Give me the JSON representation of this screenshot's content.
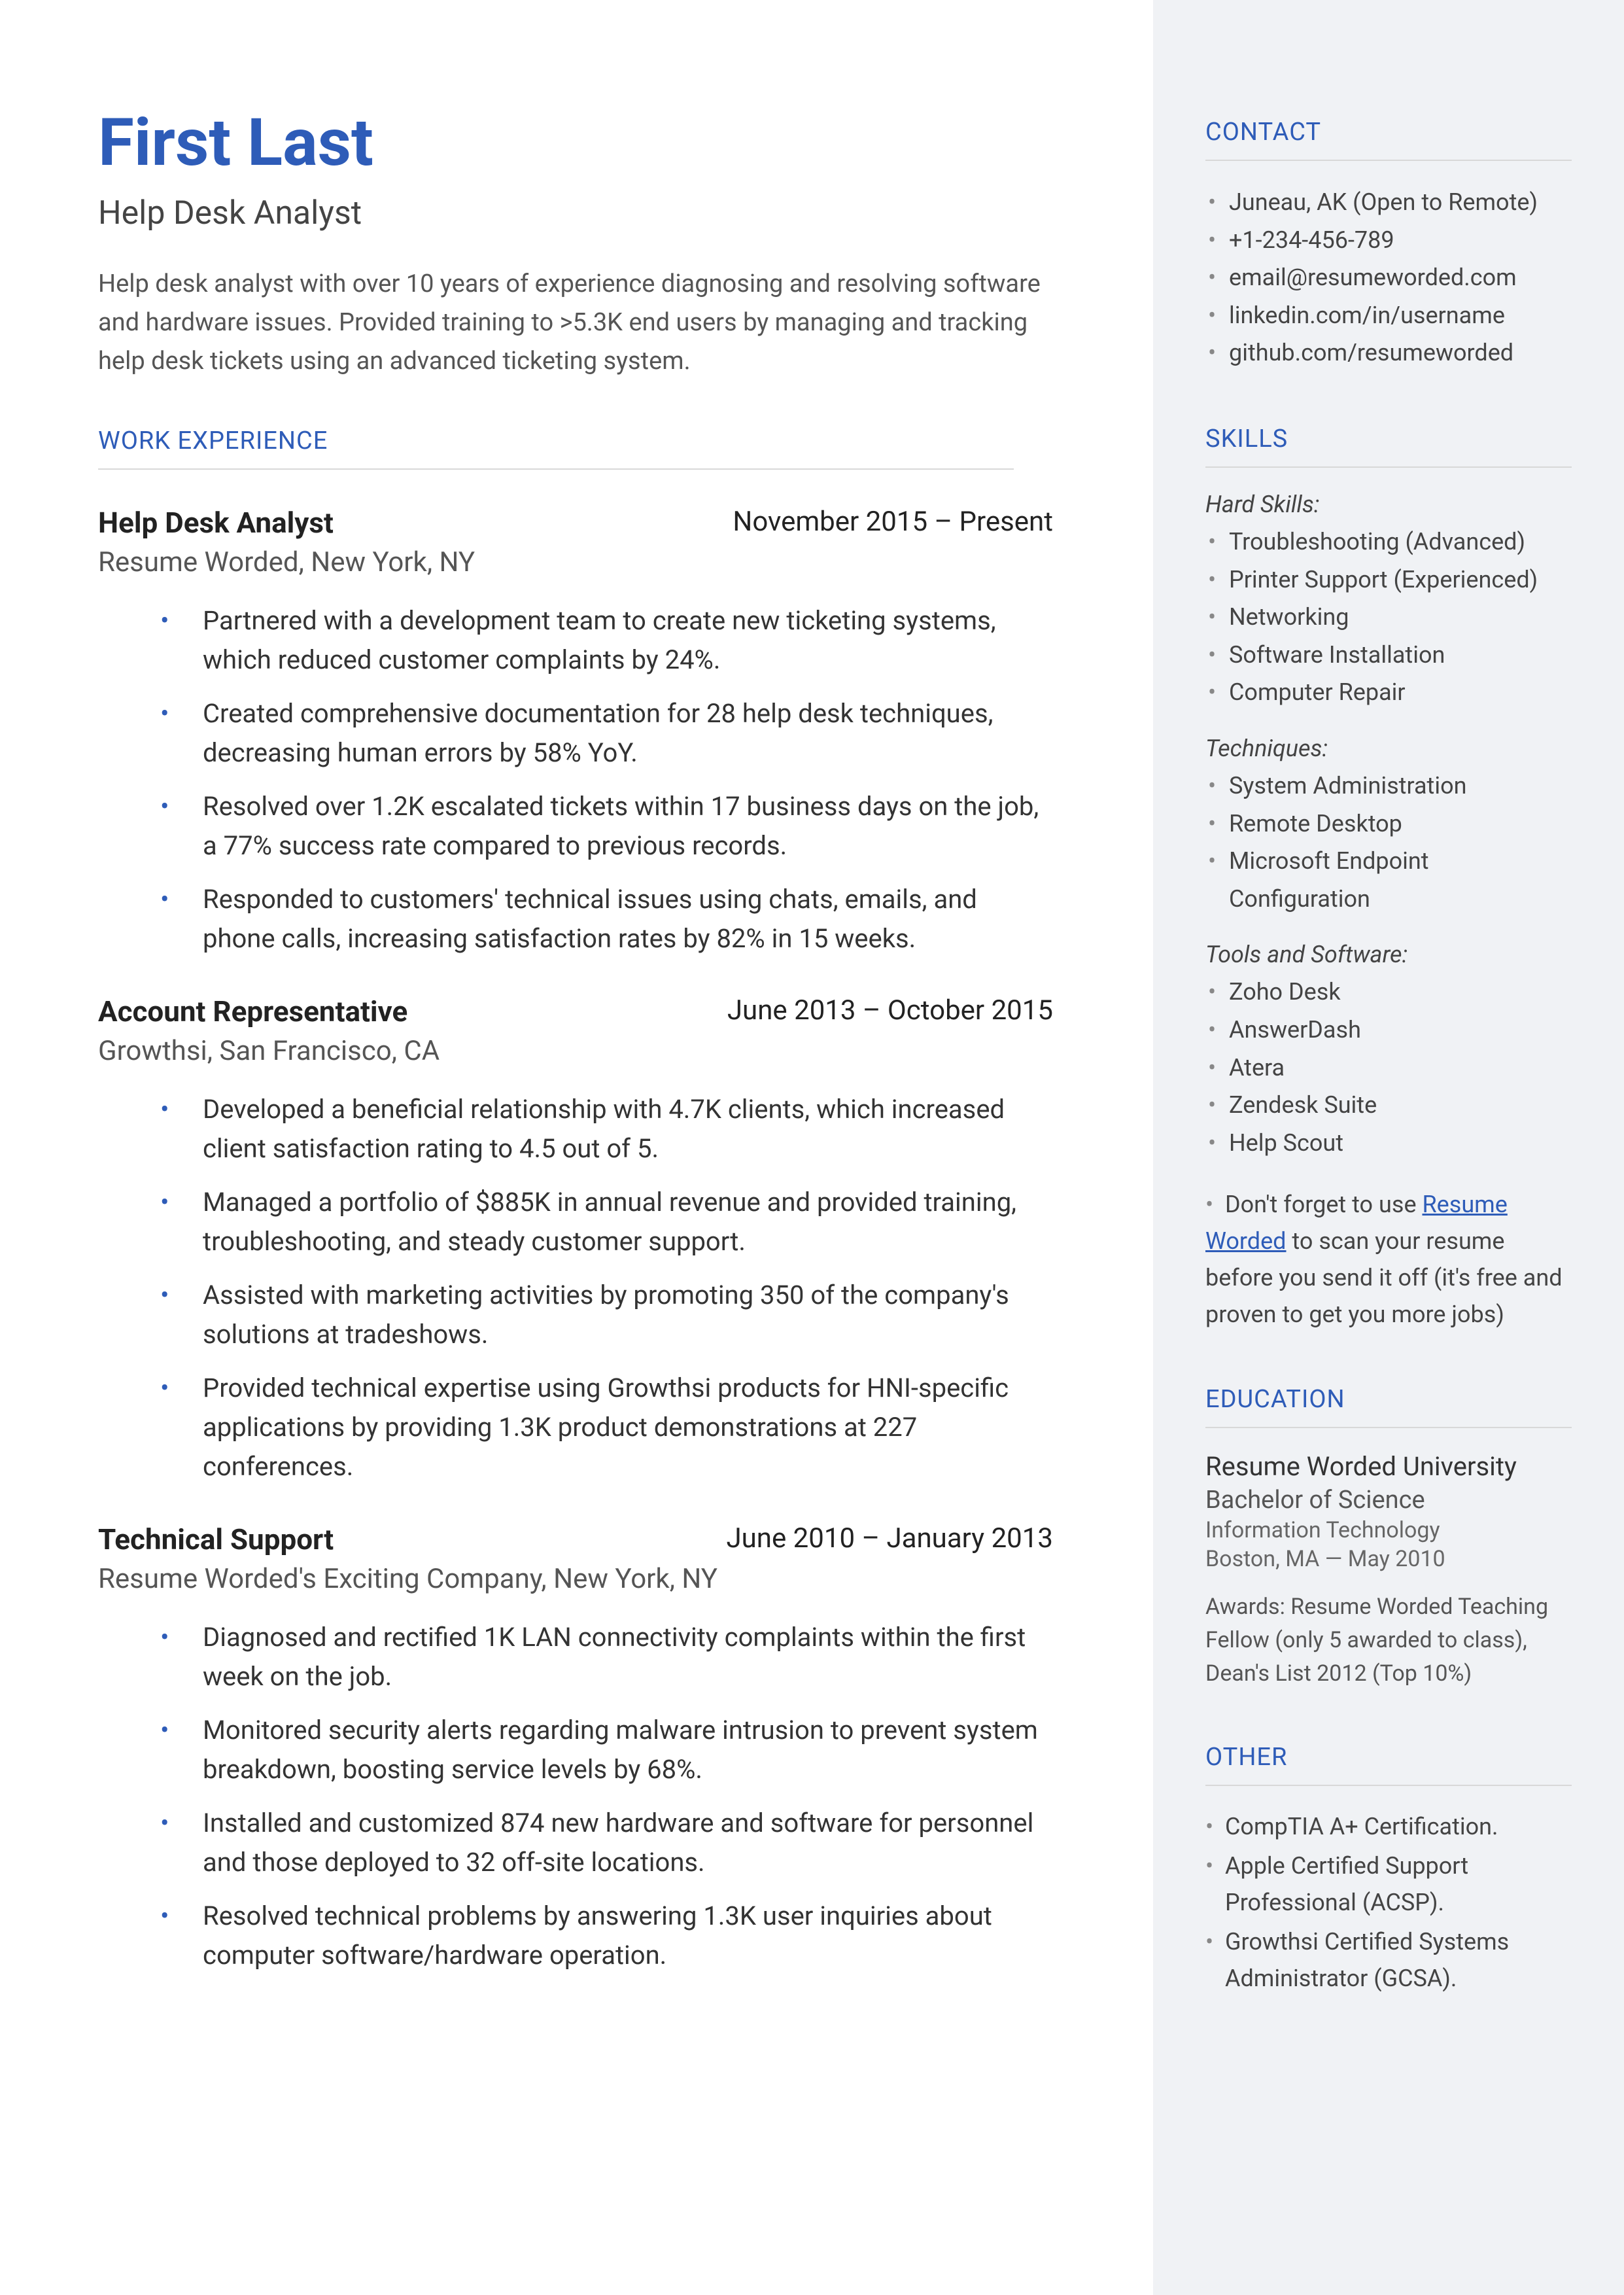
{
  "header": {
    "name": "First Last",
    "title": "Help Desk Analyst",
    "summary": "Help desk analyst with over 10 years of experience diagnosing and resolving software and hardware issues. Provided training to >5.3K end users by managing and tracking help desk tickets using an advanced ticketing system."
  },
  "sections": {
    "work_experience_label": "WORK EXPERIENCE",
    "contact_label": "CONTACT",
    "skills_label": "SKILLS",
    "education_label": "EDUCATION",
    "other_label": "OTHER"
  },
  "jobs": [
    {
      "title": "Help Desk Analyst",
      "dates": "November 2015 – Present",
      "location": "Resume Worded, New York, NY",
      "bullets": [
        "Partnered with a development team to create new ticketing systems, which reduced customer complaints by 24%.",
        "Created comprehensive documentation for 28 help desk techniques, decreasing human errors by 58% YoY.",
        "Resolved over 1.2K escalated tickets within 17 business days on the job, a 77% success rate compared to previous records.",
        "Responded to customers' technical issues using chats, emails, and phone calls, increasing satisfaction rates by 82% in 15 weeks."
      ]
    },
    {
      "title": "Account Representative",
      "dates": "June 2013 – October 2015",
      "location": "Growthsi, San Francisco, CA",
      "bullets": [
        "Developed a beneficial relationship with 4.7K clients, which increased client satisfaction rating to 4.5 out of 5.",
        "Managed a portfolio of $885K in annual revenue and provided training, troubleshooting, and steady customer support.",
        "Assisted with marketing activities by promoting 350 of the company's solutions at tradeshows.",
        "Provided technical expertise using Growthsi products for HNI-specific applications by providing 1.3K product demonstrations at 227 conferences."
      ]
    },
    {
      "title": "Technical Support",
      "dates": "June 2010 – January 2013",
      "location": "Resume Worded's Exciting Company, New York, NY",
      "bullets": [
        "Diagnosed and rectified 1K LAN connectivity complaints within the first week on the job.",
        "Monitored security alerts regarding malware intrusion to prevent system breakdown, boosting service levels by 68%.",
        "Installed and customized 874 new hardware and software for personnel and those deployed to 32 off-site locations.",
        "Resolved technical problems by answering 1.3K user inquiries about computer software/hardware operation."
      ]
    }
  ],
  "contact": [
    "Juneau, AK (Open to Remote)",
    "+1-234-456-789",
    "email@resumeworded.com",
    "linkedin.com/in/username",
    "github.com/resumeworded"
  ],
  "skills": {
    "groups": [
      {
        "label": "Hard Skills:",
        "items": [
          "Troubleshooting (Advanced)",
          "Printer Support (Experienced)",
          "Networking",
          "Software Installation",
          "Computer Repair"
        ]
      },
      {
        "label": "Techniques:",
        "items": [
          "System Administration",
          "Remote Desktop",
          "Microsoft Endpoint Configuration"
        ]
      },
      {
        "label": "Tools and Software:",
        "items": [
          "Zoho Desk",
          "AnswerDash",
          "Atera",
          "Zendesk Suite",
          "Help Scout"
        ]
      }
    ],
    "note_pre": "Don't forget to use ",
    "note_link": "Resume Worded",
    "note_post": " to scan your resume before you send it off (it's free and proven to get you more jobs)"
  },
  "education": {
    "school": "Resume Worded University",
    "degree": "Bachelor of Science",
    "field": "Information Technology",
    "location": "Boston, MA — May 2010",
    "awards": "Awards: Resume Worded Teaching Fellow (only 5 awarded to class), Dean's List 2012 (Top 10%)"
  },
  "other": [
    "CompTIA A+ Certification.",
    "Apple Certified Support Professional (ACSP).",
    "Growthsi Certified Systems Administrator (GCSA)."
  ]
}
